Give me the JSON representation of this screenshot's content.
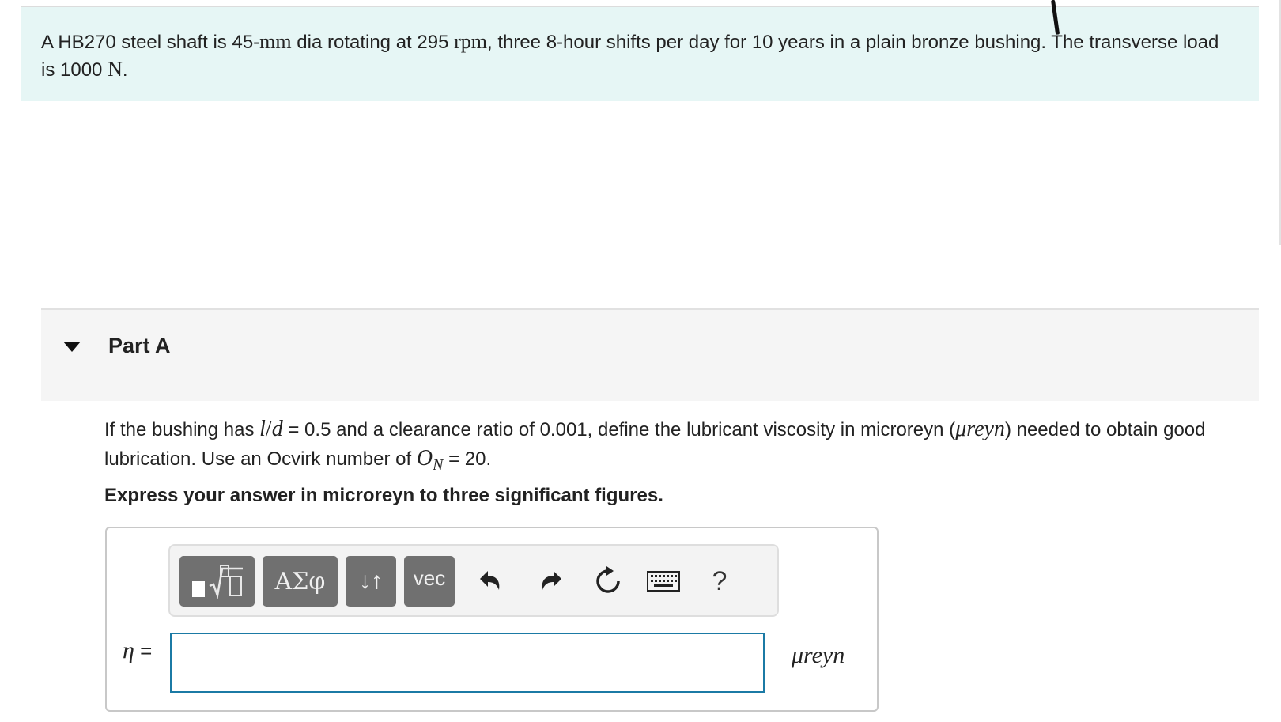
{
  "problem": {
    "intro_parts": [
      "A HB270 steel shaft is 45-",
      "mm",
      " dia rotating at 295 ",
      "rpm",
      ", three 8-hour shifts per day for 10 years in a plain bronze bushing. The transverse load is 1000 ",
      "N",
      "."
    ]
  },
  "part": {
    "title": "Part A",
    "question_parts": [
      "If the bushing has ",
      "l",
      "/",
      "d",
      " = 0.5 and a clearance ratio of 0.001, define the lubricant viscosity in microreyn (",
      "μreyn",
      ") needed to obtain good lubrication. Use an Ocvirk number of ",
      "O",
      "N",
      " = 20."
    ],
    "instruction": "Express your answer in microreyn to three significant figures."
  },
  "toolbar": {
    "greek_label": "ΑΣφ",
    "arrows_label": "↓↑",
    "vec_label": "vec",
    "help_label": "?"
  },
  "answer": {
    "variable": "η",
    "equals": " =",
    "value": "",
    "unit": "μreyn"
  },
  "colors": {
    "intro_background": "#e6f6f5",
    "part_header_background": "#f5f5f5",
    "toolbar_button": "#707070",
    "input_border": "#1b7aa5"
  }
}
